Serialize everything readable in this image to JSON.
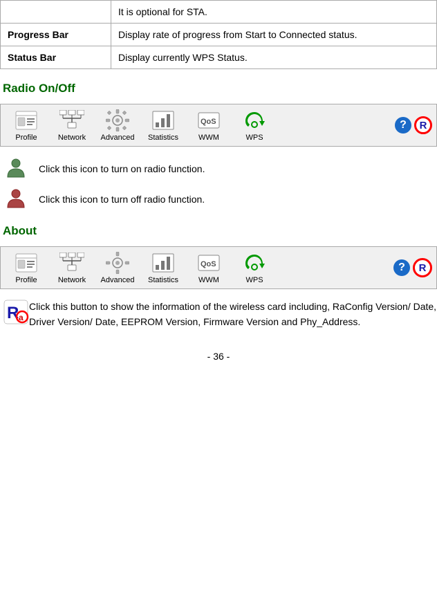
{
  "topTable": {
    "rows": [
      {
        "label": "",
        "value": "It is optional for STA."
      },
      {
        "label": "Progress Bar",
        "value": "Display rate of progress from Start to Connected status."
      },
      {
        "label": "Status Bar",
        "value": "Display currently WPS Status."
      }
    ]
  },
  "radioOnOff": {
    "heading": "Radio On/Off",
    "toolbar": {
      "items": [
        {
          "id": "profile",
          "label": "Profile"
        },
        {
          "id": "network",
          "label": "Network"
        },
        {
          "id": "advanced",
          "label": "Advanced"
        },
        {
          "id": "statistics",
          "label": "Statistics"
        },
        {
          "id": "wwm",
          "label": "WWM"
        },
        {
          "id": "wps",
          "label": "WPS"
        }
      ]
    },
    "descriptions": [
      {
        "id": "radio-on",
        "text": "Click this icon to turn on radio function."
      },
      {
        "id": "radio-off",
        "text": "Click this icon to turn off radio function."
      }
    ]
  },
  "about": {
    "heading": "About",
    "toolbar": {
      "items": [
        {
          "id": "profile",
          "label": "Profile"
        },
        {
          "id": "network",
          "label": "Network"
        },
        {
          "id": "advanced",
          "label": "Advanced"
        },
        {
          "id": "statistics",
          "label": "Statistics"
        },
        {
          "id": "wwm",
          "label": "WWM"
        },
        {
          "id": "wps",
          "label": "WPS"
        }
      ]
    },
    "description": "Click this button to show the information of the wireless card including, RaConfig Version/ Date, Driver Version/ Date, EEPROM Version, Firmware Version and Phy_Address."
  },
  "pageNumber": "- 36 -"
}
